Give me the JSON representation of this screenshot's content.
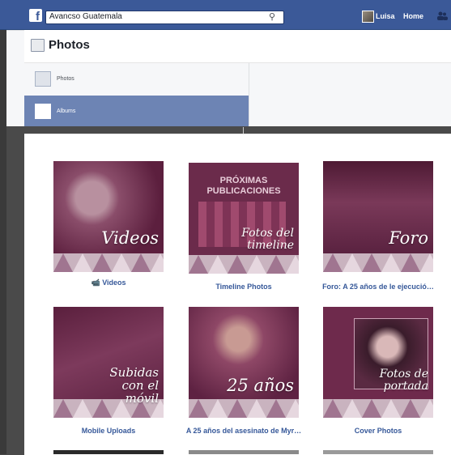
{
  "header": {
    "search_value": "Avancso Guatemala",
    "user_name": "Luisa",
    "home_label": "Home"
  },
  "page": {
    "title": "Photos"
  },
  "menu": {
    "items": [
      {
        "label": "Photos",
        "selected": false
      },
      {
        "label": "Albums",
        "selected": true
      }
    ]
  },
  "albums": [
    {
      "caption": "Videos",
      "overlay": "Videos"
    },
    {
      "caption": "Timeline Photos",
      "overlay_heading": "PRÓXIMAS PUBLICACIONES",
      "overlay": "Fotos del timeline"
    },
    {
      "caption": "Foro: A 25 años de le ejecució…",
      "overlay": "Foro"
    },
    {
      "caption": "Mobile Uploads",
      "overlay": "Subidas con el móvil"
    },
    {
      "caption": "A 25 años del asesinato de Myr…",
      "overlay": "25 años"
    },
    {
      "caption": "Cover Photos",
      "overlay": "Fotos de portada"
    }
  ],
  "colors": {
    "brand_blue": "#3b5998",
    "selected_menu": "#6d84b4",
    "album_tint": "#6e2a4c",
    "link": "#365899"
  }
}
